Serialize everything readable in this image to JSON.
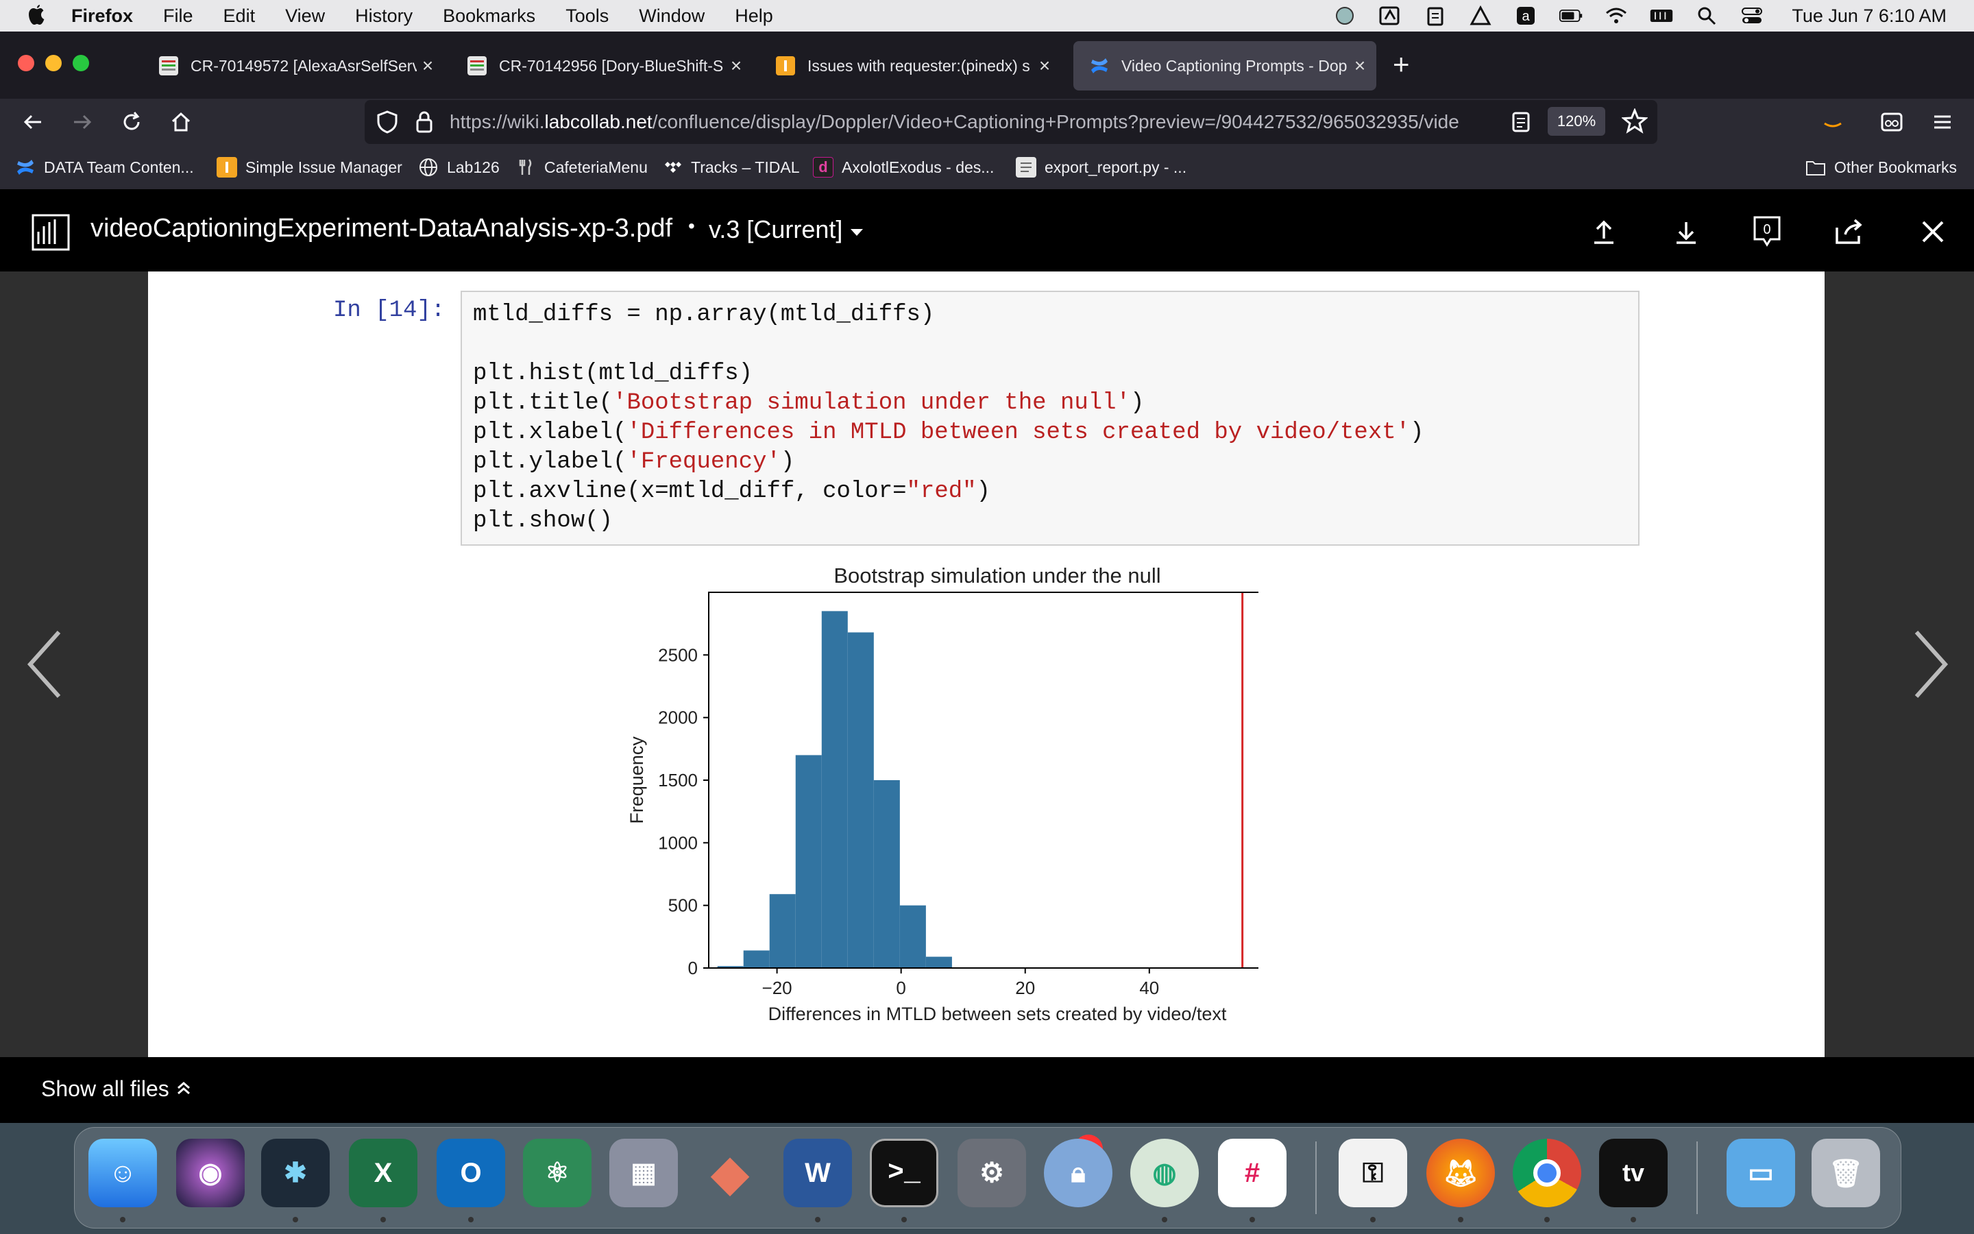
{
  "menubar": {
    "app_name": "Firefox",
    "menus": [
      "File",
      "Edit",
      "View",
      "History",
      "Bookmarks",
      "Tools",
      "Window",
      "Help"
    ],
    "clock": "Tue Jun 7  6:10 AM"
  },
  "tabs": [
    {
      "label": "CR-70149572 [AlexaAsrSelfServ",
      "icon": "document-icon"
    },
    {
      "label": "CR-70142956 [Dory-BlueShift-S",
      "icon": "document-icon"
    },
    {
      "label": "Issues with requester:(pinedx) s",
      "icon": "issue-manager-icon"
    },
    {
      "label": "Video Captioning Prompts - Dop",
      "icon": "confluence-icon"
    }
  ],
  "urlbar": {
    "url_prefix": "https://wiki.",
    "url_host": "labcollab.net",
    "url_path": "/confluence/display/Doppler/Video+Captioning+Prompts?preview=/904427532/965032935/vide",
    "zoom": "120%"
  },
  "bookmarks": [
    {
      "label": "DATA Team Conten...",
      "icon": "confluence-icon"
    },
    {
      "label": "Simple Issue Manager",
      "icon": "issue-manager-icon"
    },
    {
      "label": "Lab126",
      "icon": "globe-icon"
    },
    {
      "label": "CafeteriaMenu",
      "icon": "fork-knife-icon"
    },
    {
      "label": "Tracks – TIDAL",
      "icon": "tidal-icon"
    },
    {
      "label": "AxolotlExodus - des...",
      "icon": "d-icon"
    },
    {
      "label": "export_report.py - ...",
      "icon": "document-icon"
    }
  ],
  "other_bookmarks": "Other Bookmarks",
  "preview": {
    "filename": "videoCaptioningExperiment-DataAnalysis-xp-3.pdf",
    "separator": "•",
    "version": "v.3 [Current]",
    "comment_count": "0"
  },
  "notebook": {
    "prompt": "In [14]:",
    "code": [
      [
        {
          "t": "mtld_diffs = np.array(mtld_diffs)"
        }
      ],
      [],
      [
        {
          "t": "plt.hist(mtld_diffs)"
        }
      ],
      [
        {
          "t": "plt.title("
        },
        {
          "t": "'Bootstrap simulation under the null'",
          "s": true
        },
        {
          "t": ")"
        }
      ],
      [
        {
          "t": "plt.xlabel("
        },
        {
          "t": "'Differences in MTLD between sets created by video/text'",
          "s": true
        },
        {
          "t": ")"
        }
      ],
      [
        {
          "t": "plt.ylabel("
        },
        {
          "t": "'Frequency'",
          "s": true
        },
        {
          "t": ")"
        }
      ],
      [
        {
          "t": "plt.axvline(x=mtld_diff, color="
        },
        {
          "t": "\"red\"",
          "s": true
        },
        {
          "t": ")"
        }
      ],
      [
        {
          "t": "plt.show()"
        }
      ]
    ]
  },
  "chart_data": {
    "type": "bar",
    "title": "Bootstrap simulation under the null",
    "xlabel": "Differences in MTLD between sets created by video/text",
    "ylabel": "Frequency",
    "xlim": [
      -31,
      62
    ],
    "ylim": [
      0,
      3000
    ],
    "xticks": [
      "−20",
      "0",
      "20",
      "40"
    ],
    "xtick_values": [
      -20,
      0,
      20,
      40
    ],
    "yticks": [
      "0",
      "500",
      "1000",
      "1500",
      "2000",
      "2500"
    ],
    "ytick_values": [
      0,
      500,
      1000,
      1500,
      2000,
      2500
    ],
    "bins": [
      {
        "x0": -29.6,
        "x1": -25.4,
        "value": 15
      },
      {
        "x0": -25.4,
        "x1": -21.2,
        "value": 140
      },
      {
        "x0": -21.2,
        "x1": -17.0,
        "value": 590
      },
      {
        "x0": -17.0,
        "x1": -12.8,
        "value": 1700
      },
      {
        "x0": -12.8,
        "x1": -8.6,
        "value": 2850
      },
      {
        "x0": -8.6,
        "x1": -4.4,
        "value": 2680
      },
      {
        "x0": -4.4,
        "x1": -0.2,
        "value": 1500
      },
      {
        "x0": -0.2,
        "x1": 4.0,
        "value": 500
      },
      {
        "x0": 4.0,
        "x1": 8.2,
        "value": 90
      }
    ],
    "axvline": {
      "x": 55,
      "color": "red"
    },
    "bar_color": "#3274a1"
  },
  "files_bar": {
    "label": "Show all files"
  },
  "colors": {
    "accent": "#3274a1",
    "red_line": "#d62728",
    "code_string": "#ba2121",
    "prompt": "#303f9f"
  }
}
